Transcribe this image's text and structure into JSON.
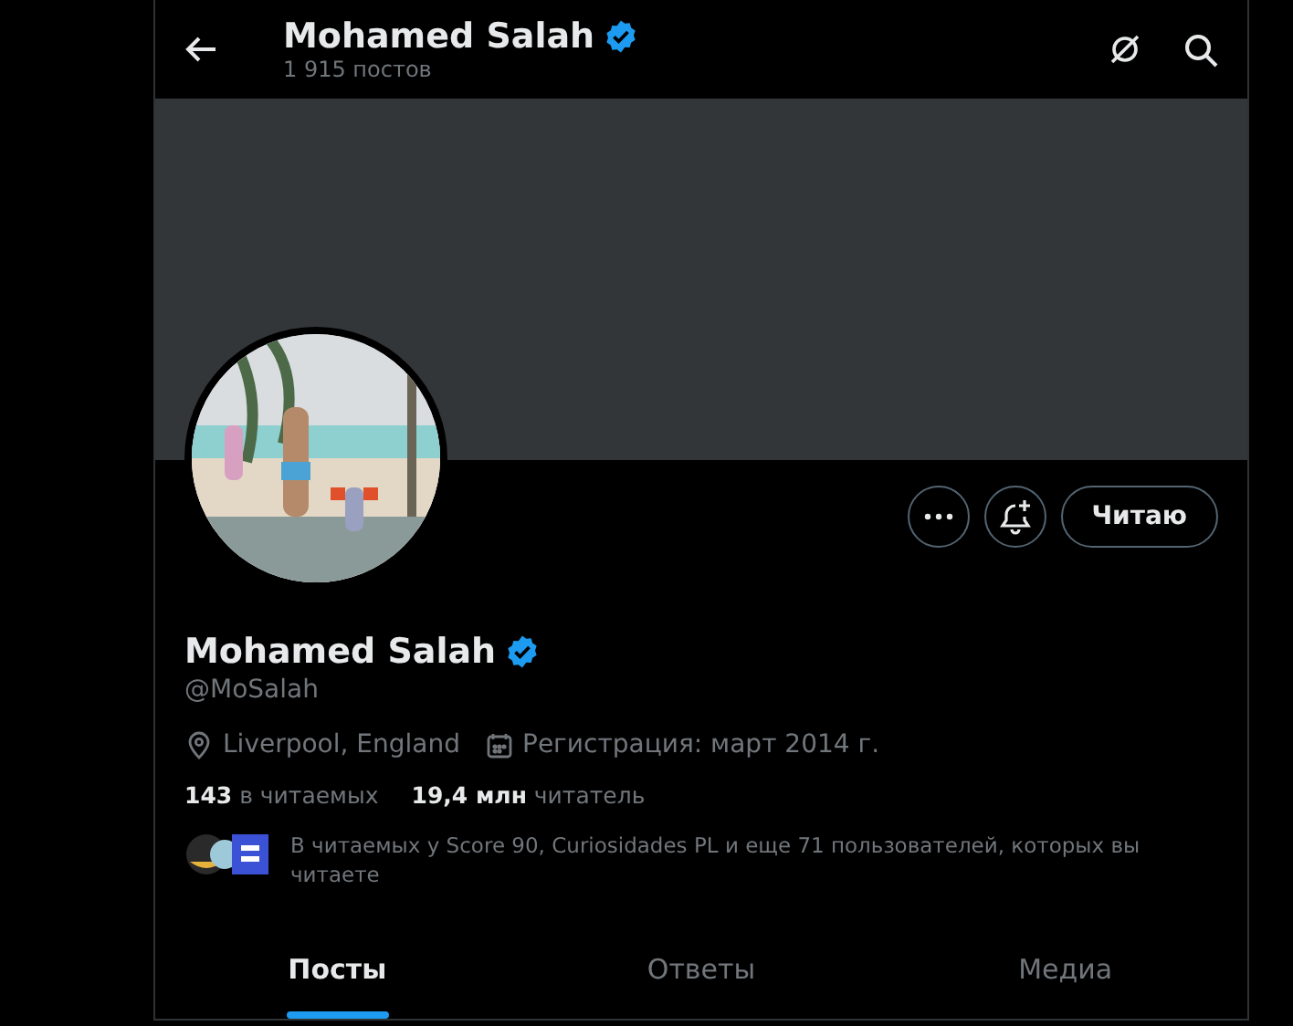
{
  "header": {
    "title": "Mohamed Salah",
    "verified": true,
    "subtitle": "1 915 постов"
  },
  "profile": {
    "avatar": {
      "kind": "picture"
    },
    "name": "Mohamed Salah",
    "verified": true,
    "handle": "@MoSalah",
    "location": "Liverpool, England",
    "joined": "Регистрация: март 2014 г.",
    "stats": [
      "**143** в читаемых",
      "**19,4 млн** читатель"
    ],
    "actions": [
      {
        "kind": "more"
      },
      {
        "kind": "notify"
      },
      {
        "kind": "text",
        "label": "Читаю"
      }
    ],
    "followed_by": "В читаемых у Score 90, Curiosidades PL и еще 71 пользователей, которых вы читаете"
  },
  "tabs": [
    {
      "label": "Посты",
      "selected": true
    },
    {
      "label": "Ответы",
      "selected": false
    },
    {
      "label": "Медиа",
      "selected": false
    }
  ]
}
